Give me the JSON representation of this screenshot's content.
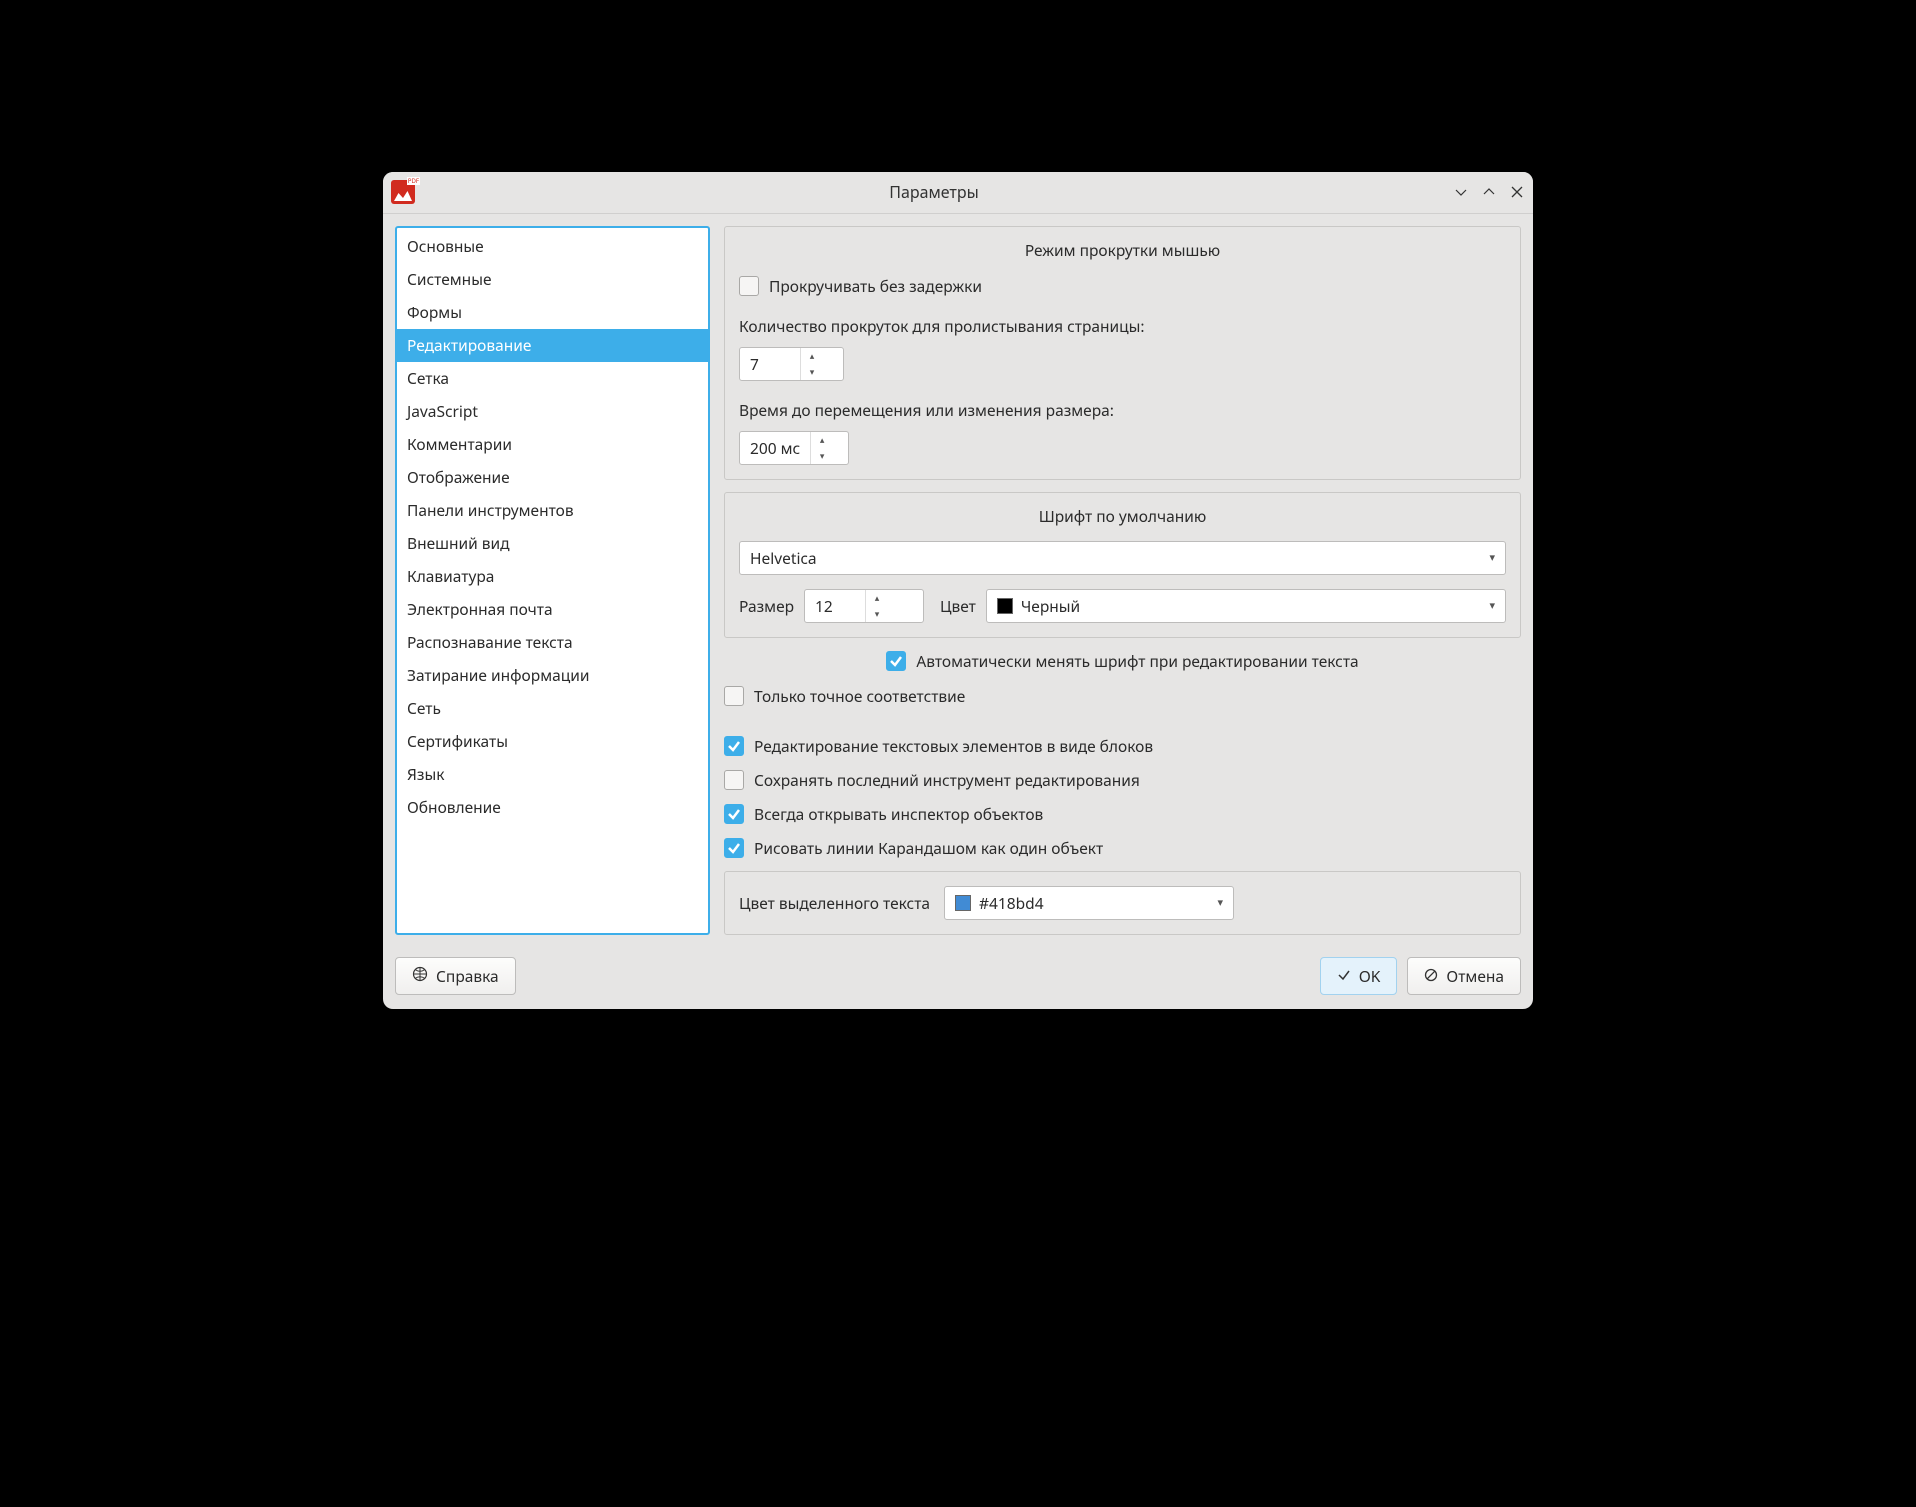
{
  "window": {
    "title": "Параметры"
  },
  "sidebar": {
    "items": [
      "Основные",
      "Системные",
      "Формы",
      "Редактирование",
      "Сетка",
      "JavaScript",
      "Комментарии",
      "Отображение",
      "Панели инструментов",
      "Внешний вид",
      "Клавиатура",
      "Электронная почта",
      "Распознавание текста",
      "Затирание информации",
      "Сеть",
      "Сертификаты",
      "Язык",
      "Обновление"
    ],
    "selected_index": 3
  },
  "scroll_group": {
    "title": "Режим прокрутки мышью",
    "no_delay_label": "Прокручивать без задержки",
    "no_delay_checked": false,
    "count_label": "Количество прокруток для пролистывания страницы:",
    "count_value": "7",
    "time_label": "Время до перемещения или изменения размера:",
    "time_value": "200 мс"
  },
  "font_group": {
    "title": "Шрифт по умолчанию",
    "font_value": "Helvetica",
    "size_label": "Размер",
    "size_value": "12",
    "color_label": "Цвет",
    "color_value": "Черный",
    "color_swatch": "#000000"
  },
  "options": {
    "auto_font_label": "Автоматически менять шрифт при редактировании текста",
    "auto_font_checked": true,
    "exact_match_label": "Только точное соответствие",
    "exact_match_checked": false,
    "blocks_label": "Редактирование текстовых элементов в виде блоков",
    "blocks_checked": true,
    "save_tool_label": "Сохранять последний инструмент редактирования",
    "save_tool_checked": false,
    "inspector_label": "Всегда открывать инспектор объектов",
    "inspector_checked": true,
    "pencil_label": "Рисовать линии Карандашом как один объект",
    "pencil_checked": true
  },
  "highlight": {
    "label": "Цвет выделенного текста",
    "value": "#418bd4"
  },
  "footer": {
    "help_label": "Справка",
    "ok_label": "OK",
    "cancel_label": "Отмена"
  }
}
